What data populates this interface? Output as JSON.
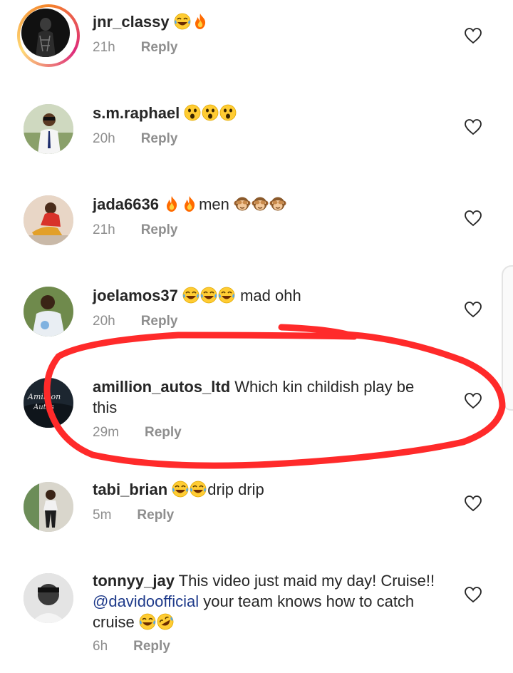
{
  "comments": [
    {
      "username": "jnr_classy",
      "text": "",
      "emoji": [
        "joy",
        "fire"
      ],
      "time": "21h",
      "reply": "Reply"
    },
    {
      "username": "s.m.raphael",
      "text": "",
      "emoji": [
        "astonished",
        "astonished",
        "astonished"
      ],
      "time": "20h",
      "reply": "Reply"
    },
    {
      "username": "jada6636",
      "text_a": "men",
      "time": "21h",
      "reply": "Reply"
    },
    {
      "username": "joelamos37",
      "text": "mad ohh",
      "emoji": [
        "joy",
        "joy",
        "joy"
      ],
      "time": "20h",
      "reply": "Reply"
    },
    {
      "username": "amillion_autos_ltd",
      "text": "Which kin childish play be this",
      "time": "29m",
      "reply": "Reply"
    },
    {
      "username": "tabi_brian",
      "text": "drip drip",
      "emoji": [
        "joy",
        "joy"
      ],
      "time": "5m",
      "reply": "Reply"
    },
    {
      "username": "tonnyy_jay",
      "text_a": "This video just maid my day! Cruise!!",
      "mention": "@davidoofficial",
      "text_b": "your team knows how to catch cruise",
      "time": "6h",
      "reply": "Reply"
    }
  ],
  "colors": {
    "annotation": "#ff2a2a",
    "meta": "#8e8e8e",
    "mention": "#1e3a8a"
  },
  "icons": {
    "like": "heart-icon",
    "emoji_a": "face-with-tears-of-joy",
    "emoji_b": "fire",
    "emoji_c": "astonished-face",
    "emoji_d": "see-no-evil-monkey",
    "emoji_e": "rolling-on-floor-laughing"
  }
}
